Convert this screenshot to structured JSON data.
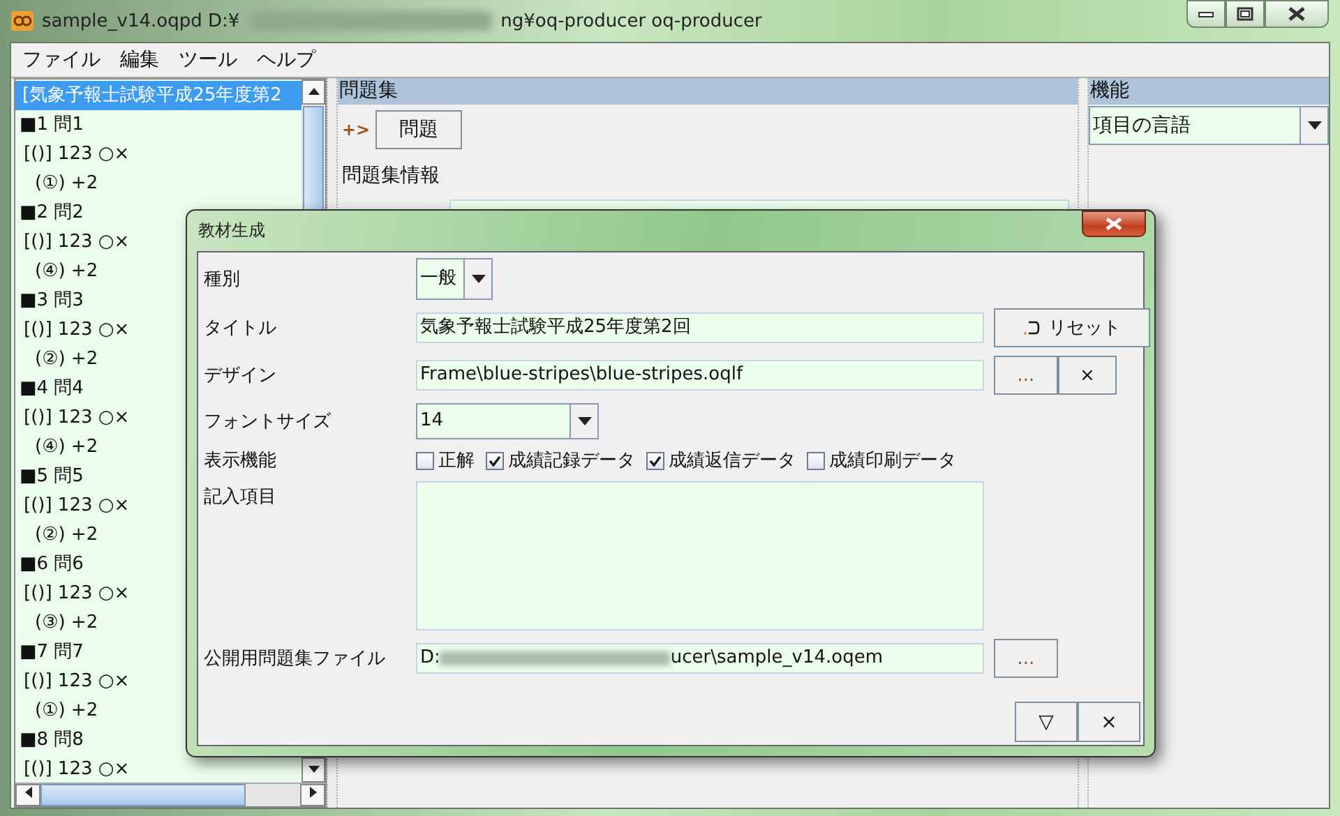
{
  "window": {
    "title_start": "sample_v14.oqpd  D:¥",
    "title_end": "ng¥oq-producer    oq-producer"
  },
  "menu": [
    "ファイル",
    "編集",
    "ツール",
    "ヘルプ"
  ],
  "tree": {
    "items": [
      {
        "label": "[気象予報士試験平成25年度第2",
        "selected": true,
        "children": [
          {
            "label": "■1 問1",
            "selected": false,
            "children": [
              {
                "label": "[()] 123 ○×",
                "selected": false,
                "children": [
                  {
                    "label": "(①) +2",
                    "selected": false
                  }
                ]
              }
            ]
          },
          {
            "label": "■2 問2",
            "selected": false,
            "children": [
              {
                "label": "[()] 123 ○×",
                "selected": false,
                "children": [
                  {
                    "label": "(④) +2",
                    "selected": false
                  }
                ]
              }
            ]
          },
          {
            "label": "■3 問3",
            "selected": false,
            "children": [
              {
                "label": "[()] 123 ○×",
                "selected": false,
                "children": [
                  {
                    "label": "(②) +2",
                    "selected": false
                  }
                ]
              }
            ]
          },
          {
            "label": "■4 問4",
            "selected": false,
            "children": [
              {
                "label": "[()] 123 ○×",
                "selected": false,
                "children": [
                  {
                    "label": "(④) +2",
                    "selected": false
                  }
                ]
              }
            ]
          },
          {
            "label": "■5 問5",
            "selected": false,
            "children": [
              {
                "label": "[()] 123 ○×",
                "selected": false,
                "children": [
                  {
                    "label": "(②) +2",
                    "selected": false
                  }
                ]
              }
            ]
          },
          {
            "label": "■6 問6",
            "selected": false,
            "children": [
              {
                "label": "[()] 123 ○×",
                "selected": false,
                "children": [
                  {
                    "label": "(③) +2",
                    "selected": false
                  }
                ]
              }
            ]
          },
          {
            "label": "■7 問7",
            "selected": false,
            "children": [
              {
                "label": "[()] 123 ○×",
                "selected": false,
                "children": [
                  {
                    "label": "(①) +2",
                    "selected": false
                  }
                ]
              }
            ]
          },
          {
            "label": "■8 問8",
            "selected": false,
            "children": [
              {
                "label": "[()] 123 ○×",
                "selected": false
              }
            ]
          }
        ]
      }
    ]
  },
  "middle": {
    "header": "問題集",
    "add_label": "+>",
    "add_button": "問題",
    "section": "問題集情報"
  },
  "right": {
    "header": "機能",
    "combo": "項目の言語"
  },
  "dialog": {
    "title": "教材生成",
    "type_label": "種別",
    "type_value": "一般",
    "title_label": "タイトル",
    "title_value": "気象予報士試験平成25年度第2回",
    "reset_button": "リセット",
    "design_label": "デザイン",
    "design_value": "Frame\\blue-stripes\\blue-stripes.oqlf",
    "browse_button": "...",
    "clear_button": "×",
    "font_label": "フォントサイズ",
    "font_value": "14",
    "display_label": "表示機能",
    "options": [
      {
        "label": "正解",
        "checked": false
      },
      {
        "label": "成績記録データ",
        "checked": true
      },
      {
        "label": "成績返信データ",
        "checked": true
      },
      {
        "label": "成績印刷データ",
        "checked": false
      }
    ],
    "entry_label": "記入項目",
    "file_label": "公開用問題集ファイル",
    "file_start": "D:",
    "file_end": "ucer\\sample_v14.oqem",
    "file_button": "...",
    "ok_button": "▽",
    "cancel_button": "×"
  }
}
